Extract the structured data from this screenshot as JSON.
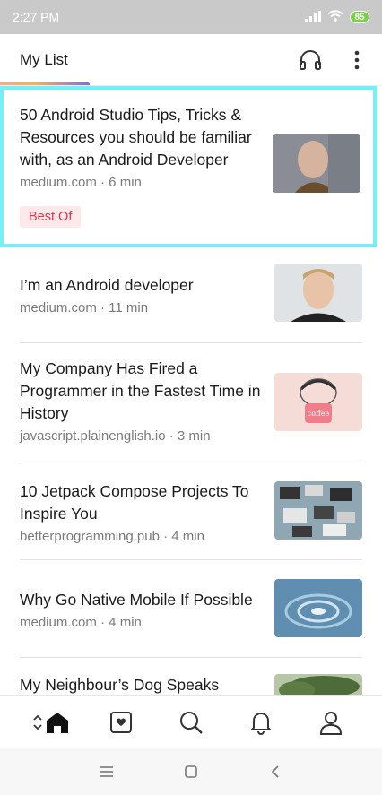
{
  "status_bar": {
    "time": "2:27 PM",
    "battery": "85"
  },
  "header": {
    "title": "My List",
    "icons": [
      "headphones-icon",
      "more-vertical-icon"
    ]
  },
  "articles": [
    {
      "title": "50 Android Studio Tips, Tricks & Resources you should be familiar with, as an Android Developer",
      "meta": "medium.com · 6 min",
      "badge": "Best Of",
      "selected": true
    },
    {
      "title": "I’m an Android developer",
      "meta": "medium.com · 11 min"
    },
    {
      "title": "My Company Has Fired a Programmer in the Fastest Time in History",
      "meta": "javascript.plainenglish.io · 3 min"
    },
    {
      "title": "10 Jetpack Compose Projects To Inspire You",
      "meta": "betterprogramming.pub · 4 min"
    },
    {
      "title": "Why Go Native Mobile If Possible",
      "meta": "medium.com · 4 min"
    },
    {
      "title": "My Neighbour’s Dog Speaks",
      "meta": ""
    }
  ],
  "bottom_nav": [
    "home-icon",
    "saved-icon",
    "search-icon",
    "notifications-icon",
    "profile-icon"
  ],
  "system_nav": [
    "menu-icon",
    "home-square-icon",
    "back-icon"
  ],
  "colors": {
    "badge_bg": "#fde8ea",
    "badge_text": "#d23a52",
    "selection_border": "#72f0f4",
    "battery": "#7ccd4b"
  }
}
